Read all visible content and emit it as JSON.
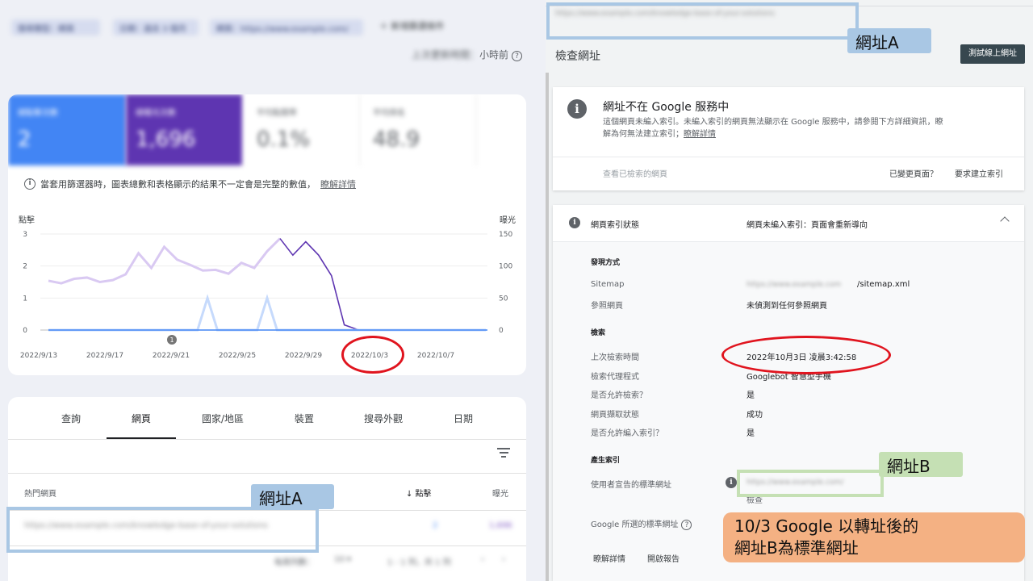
{
  "left": {
    "filters": [
      "搜尋類型：網頁",
      "日期：過去 3 個月",
      "網頁：https://www.example.com/"
    ],
    "new_filter": "＋ 新增篩選條件",
    "updated_prefix": "上次更新時間：",
    "updated_suffix": "小時前",
    "metrics": [
      {
        "label": "總點擊次數",
        "value": "2"
      },
      {
        "label": "總曝光次數",
        "value": "1,696"
      },
      {
        "label": "平均點閱率",
        "value": "0.1%"
      },
      {
        "label": "平均排名",
        "value": "48.9"
      }
    ],
    "note": "當套用篩選器時，圖表總數和表格顯示的結果不一定會是完整的數值，",
    "note_link": "瞭解詳情",
    "tabs": [
      "查詢",
      "網頁",
      "國家/地區",
      "裝置",
      "搜尋外觀",
      "日期"
    ],
    "table": {
      "col_page": "熱門網頁",
      "col_clicks": "↓ 點擊",
      "col_impr": "曝光",
      "rows": [
        {
          "url": "https://www.example.com/knowledge-base-of-your-solutions",
          "clicks": "2",
          "impr": "1,696"
        }
      ],
      "pager_rows": "每頁列數：",
      "pager_num": "10 ▾",
      "pager_range": "1 - 1 列，共 1 列",
      "pager_prev": "‹",
      "pager_next": "›"
    }
  },
  "chart_data": {
    "type": "line",
    "title": "",
    "left_axis_label": "點擊",
    "right_axis_label": "曝光",
    "ylim_left": [
      0,
      3
    ],
    "ylim_right": [
      0,
      150
    ],
    "left_ticks": [
      "3",
      "2",
      "1",
      "0"
    ],
    "right_ticks": [
      "150",
      "100",
      "50",
      "0"
    ],
    "x_tick_labels": [
      "2022/9/13",
      "2022/9/17",
      "2022/9/21",
      "2022/9/25",
      "2022/9/29",
      "2022/10/3",
      "2022/10/7"
    ],
    "annotation_marker": "1",
    "series": [
      {
        "name": "點擊",
        "color": "#4285f4",
        "faded": true,
        "values": [
          0,
          0,
          0,
          0,
          0,
          0,
          0,
          0,
          0,
          0,
          0,
          0,
          0,
          0,
          0,
          0,
          1,
          0,
          0,
          0,
          0,
          0,
          1,
          0,
          0,
          0,
          0,
          0,
          0,
          0,
          0,
          0,
          0,
          0,
          0,
          0,
          0,
          0,
          0,
          0,
          0,
          0,
          0,
          0,
          0
        ]
      },
      {
        "name": "曝光",
        "color": "#5e35b1",
        "values": [
          77,
          73,
          80,
          82,
          75,
          78,
          87,
          120,
          97,
          130,
          110,
          102,
          93,
          94,
          88,
          105,
          97,
          123,
          143,
          117,
          138,
          117,
          85,
          8,
          1,
          0,
          0,
          0,
          0,
          0,
          0,
          0,
          0,
          0,
          0
        ]
      }
    ]
  },
  "right": {
    "top_url": "https://www.example.com/knowledge-base-of-your-solutions",
    "inspect_title": "檢查網址",
    "test_live_btn": "測試線上網址",
    "status_title": "網址不在 Google 服務中",
    "status_desc": "這個網頁未編入索引。未編入索引的網頁無法顯示在 Google 服務中，請參閱下方詳細資訊，瞭解為何無法建立索引；",
    "status_link": "瞭解詳情",
    "view_crawled": "查看已檢索的網頁",
    "page_changed": "已變更頁面？",
    "request_index": "要求建立索引",
    "index_label": "網頁索引狀態",
    "index_value": "網頁未編入索引：頁面會重新導向",
    "discovery": "發現方式",
    "sitemap_label": "Sitemap",
    "sitemap_blur": "https://www.example.com",
    "sitemap_suffix": "/sitemap.xml",
    "referring_label": "參照網頁",
    "referring_value": "未偵測到任何參照網頁",
    "crawl": "檢索",
    "last_crawl_label": "上次檢索時間",
    "last_crawl_value": "2022年10月3日 凌晨3:42:58",
    "crawler_label": "檢索代理程式",
    "crawler_value": "Googlebot 智慧型手機",
    "crawl_allowed_label": "是否允許檢索？",
    "crawl_allowed_value": "是",
    "fetch_label": "網頁擷取狀態",
    "fetch_value": "成功",
    "index_allowed_label": "是否允許編入索引？",
    "index_allowed_value": "是",
    "indexing": "產生索引",
    "user_canonical_label": "使用者宣告的標準網址",
    "user_canonical_blur": "https://www.example.com/",
    "user_canonical_tail": "檢查",
    "google_canonical_label": "Google 所選的標準網址",
    "learn_more": "瞭解詳情",
    "open_report": "開啟報告"
  },
  "annotations": {
    "url_a_top": "網址A",
    "url_a_bottom": "網址A",
    "url_b": "網址B",
    "callout_line1": "10/3 Google 以轉址後的",
    "callout_line2": "網址B為標準網址"
  }
}
